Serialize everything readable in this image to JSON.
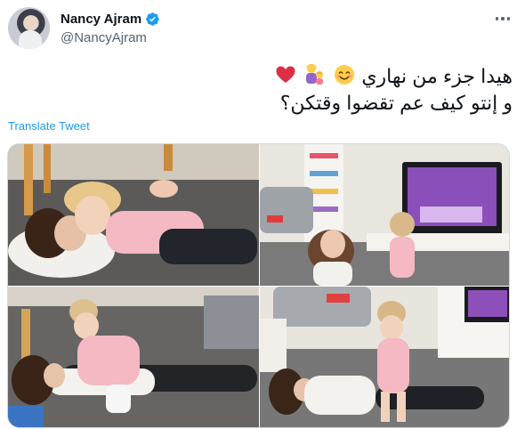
{
  "user": {
    "display_name": "Nancy Ajram",
    "handle": "@NancyAjram",
    "verified": true,
    "verified_icon": "verified-badge-icon",
    "accent_color": "#1d9bf0"
  },
  "tweet": {
    "line1": "هيدا جزء من نهاري",
    "line2": "و إنتو كيف عم تقضوا وقتكن؟",
    "emojis": [
      "smiling-face-icon",
      "mother-and-child-icon",
      "red-heart-icon"
    ]
  },
  "actions": {
    "translate_label": "Translate Tweet",
    "more_icon": "more-dots-icon"
  },
  "media": {
    "photo_count": 4,
    "photos": [
      "mother-and-daughter-cuddling-on-floor",
      "mother-and-daughter-watching-tv",
      "daughter-tickling-mother-on-floor",
      "mother-on-floor-daughter-standing"
    ]
  }
}
